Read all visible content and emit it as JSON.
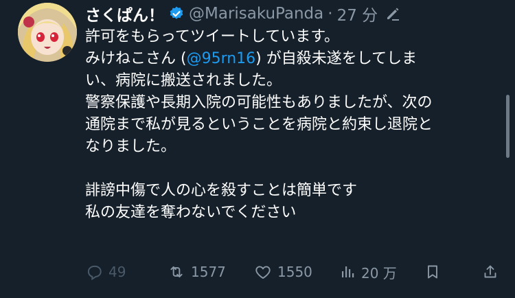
{
  "tweet": {
    "author": {
      "display_name": "さくぱん！",
      "handle": "@MarisakuPanda",
      "separator": "·",
      "time": "27 分",
      "verified": true
    },
    "body": {
      "line1": "許可をもらってツイートしています。",
      "line2_before": "みけねこさん (",
      "line2_mention": "@95rn16",
      "line2_after": ") が自殺未遂をしてしま",
      "line3": "い、病院に搬送されました。",
      "line4": "警察保護や長期入院の可能性もありましたが、次の",
      "line5": "通院まで私が見るということを病院と約束し退院と",
      "line6": "なりました。",
      "line7": "",
      "line8": "誹謗中傷で人の心を殺すことは簡単です",
      "line9": "私の友達を奪わないでください"
    },
    "metrics": {
      "replies": "49",
      "reposts": "1577",
      "likes": "1550",
      "views": "20 万"
    }
  },
  "icons": {
    "verified": "verified-badge-icon",
    "edit": "edit-pencil-icon",
    "reply": "reply-icon",
    "repost": "repost-icon",
    "like": "heart-icon",
    "views": "views-chart-icon",
    "bookmark": "bookmark-icon",
    "share": "share-icon"
  },
  "colors": {
    "background": "#15202b",
    "text": "#ffffff",
    "muted": "#8b98a5",
    "accent": "#1d9bf0"
  }
}
